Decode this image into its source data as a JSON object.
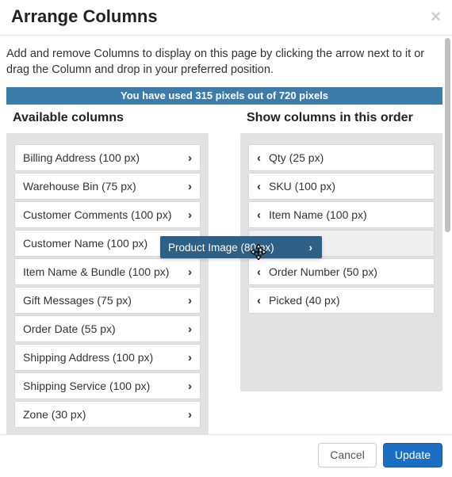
{
  "header": {
    "title": "Arrange Columns",
    "close_label": "×"
  },
  "description": "Add and remove Columns to display on this page by clicking the arrow next to it or drag the Column and drop in your preferred position.",
  "banner": "You have used 315 pixels out of 720 pixels",
  "left_heading": "Available columns",
  "right_heading": "Show columns in this order",
  "available": [
    "Billing Address (100 px)",
    "Warehouse Bin (75 px)",
    "Customer Comments (100 px)",
    "Customer Name (100 px)",
    "Item Name & Bundle (100 px)",
    "Gift Messages (75 px)",
    "Order Date (55 px)",
    "Shipping Address (100 px)",
    "Shipping Service (100 px)",
    "Zone (30 px)"
  ],
  "shown": [
    "Qty (25 px)",
    "SKU (100 px)",
    "Item Name (100 px)",
    "",
    "Order Number (50 px)",
    "Picked (40 px)"
  ],
  "drag": {
    "label": "Product Image (80 px)"
  },
  "footer": {
    "cancel": "Cancel",
    "update": "Update"
  }
}
